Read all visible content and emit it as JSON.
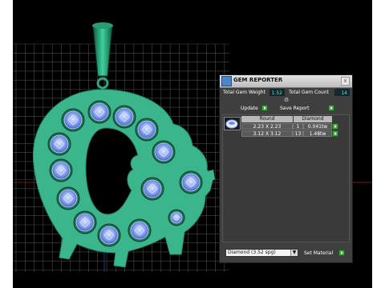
{
  "panel": {
    "title": "GEM REPORTER",
    "close_label": "x",
    "total_weight_label": "Total Gem Weight",
    "total_weight_value": "1.52",
    "total_count_label": "Total Gem Count",
    "total_count_value": "14",
    "update_label": "Update",
    "save_report_label": "Save Report",
    "table": {
      "col_shape": "Round",
      "col_material": "Diamond",
      "rows": [
        {
          "size": "2.23 X 2.23",
          "count": "1",
          "weight": "0.041tw"
        },
        {
          "size": "3.12 X 3.12",
          "count": "13",
          "weight": "1.48tw"
        }
      ]
    },
    "material_select": "Diamond    (3.52 spg)",
    "set_material_label": "Set Material"
  },
  "colors": {
    "viewport_bg": "#000000",
    "grid": "#4a4a4a",
    "pendant": "#3bb58c",
    "gem": "#6d8fe0",
    "accent_button": "#3fa33f",
    "value_text": "#5fe0e0"
  },
  "icons": [
    "gem-reporter-app-icon",
    "close-icon",
    "gear-icon",
    "play-icon",
    "dropdown-arrow-icon",
    "round-gem-icon"
  ]
}
